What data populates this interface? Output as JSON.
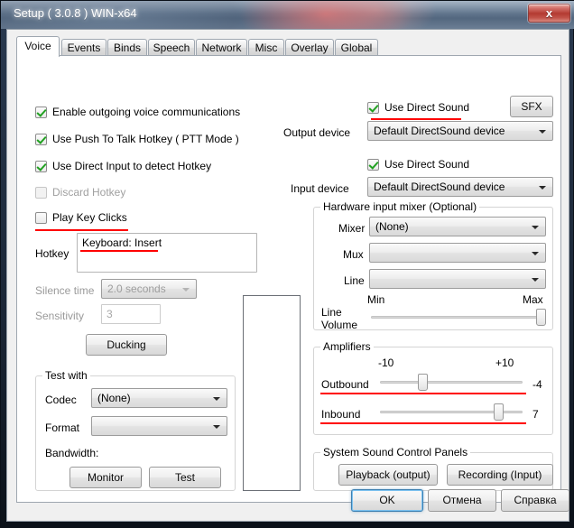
{
  "window": {
    "title": "Setup ( 3.0.8 ) WIN-x64",
    "close_icon": "close-icon",
    "close_label": "x"
  },
  "tabs": [
    {
      "label": "Voice",
      "active": true
    },
    {
      "label": "Events",
      "active": false
    },
    {
      "label": "Binds",
      "active": false
    },
    {
      "label": "Speech",
      "active": false
    },
    {
      "label": "Network",
      "active": false
    },
    {
      "label": "Misc",
      "active": false
    },
    {
      "label": "Overlay",
      "active": false
    },
    {
      "label": "Global",
      "active": false
    }
  ],
  "voice": {
    "checkboxes": [
      {
        "label": "Enable outgoing voice communications",
        "checked": true,
        "disabled": false,
        "marked": false
      },
      {
        "label": "Use Push To Talk Hotkey ( PTT Mode )",
        "checked": true,
        "disabled": false,
        "marked": false
      },
      {
        "label": "Use Direct Input to detect Hotkey",
        "checked": true,
        "disabled": false,
        "marked": false
      },
      {
        "label": "Discard Hotkey",
        "checked": false,
        "disabled": true,
        "marked": false
      },
      {
        "label": "Play Key Clicks",
        "checked": false,
        "disabled": false,
        "marked": true
      }
    ],
    "hotkey": {
      "label": "Hotkey",
      "value": "Keyboard: Insert",
      "marked": true
    },
    "silence_time": {
      "label": "Silence time",
      "value": "2.0 seconds",
      "disabled": true
    },
    "sensitivity": {
      "label": "Sensitivity",
      "value": "3",
      "disabled": true
    },
    "ducking_button": "Ducking",
    "test_with": {
      "title": "Test with",
      "codec_label": "Codec",
      "codec_value": "(None)",
      "format_label": "Format",
      "format_value": "",
      "bandwidth_label": "Bandwidth:",
      "monitor_button": "Monitor",
      "test_button": "Test"
    },
    "vu_meter_name": "input-level-meter"
  },
  "audio": {
    "output": {
      "direct_sound_label": "Use Direct Sound",
      "direct_sound_checked": true,
      "direct_sound_marked": true,
      "sfx_button": "SFX",
      "device_label": "Output device",
      "device_value": "Default DirectSound device"
    },
    "input": {
      "direct_sound_label": "Use Direct Sound",
      "direct_sound_checked": true,
      "direct_sound_marked": false,
      "device_label": "Input device",
      "device_value": "Default DirectSound device"
    },
    "mixer_group": {
      "title": "Hardware input mixer (Optional)",
      "mixer_label": "Mixer",
      "mixer_value": "(None)",
      "mux_label": "Mux",
      "mux_value": "",
      "line_label": "Line",
      "line_value": "",
      "min_label": "Min",
      "max_label": "Max",
      "volume_label_line1": "Line",
      "volume_label_line2": "Volume",
      "volume_percent": 97
    },
    "amplifiers": {
      "title": "Amplifiers",
      "min_label": "-10",
      "max_label": "+10",
      "outbound_label": "Outbound",
      "outbound_value": "-4",
      "outbound_percent": 30,
      "outbound_marked": true,
      "inbound_label": "Inbound",
      "inbound_value": "7",
      "inbound_percent": 83,
      "inbound_marked": true
    },
    "system_panels": {
      "title": "System Sound Control Panels",
      "playback_button": "Playback (output)",
      "recording_button": "Recording (Input)"
    }
  },
  "footer": {
    "ok": "OK",
    "cancel": "Отмена",
    "help": "Справка"
  },
  "colors": {
    "marker_red": "#ff0000",
    "accent_blue": "#3c7fb1",
    "dialog_bg": "#f0f0f0",
    "page_bg": "#ffffff"
  }
}
